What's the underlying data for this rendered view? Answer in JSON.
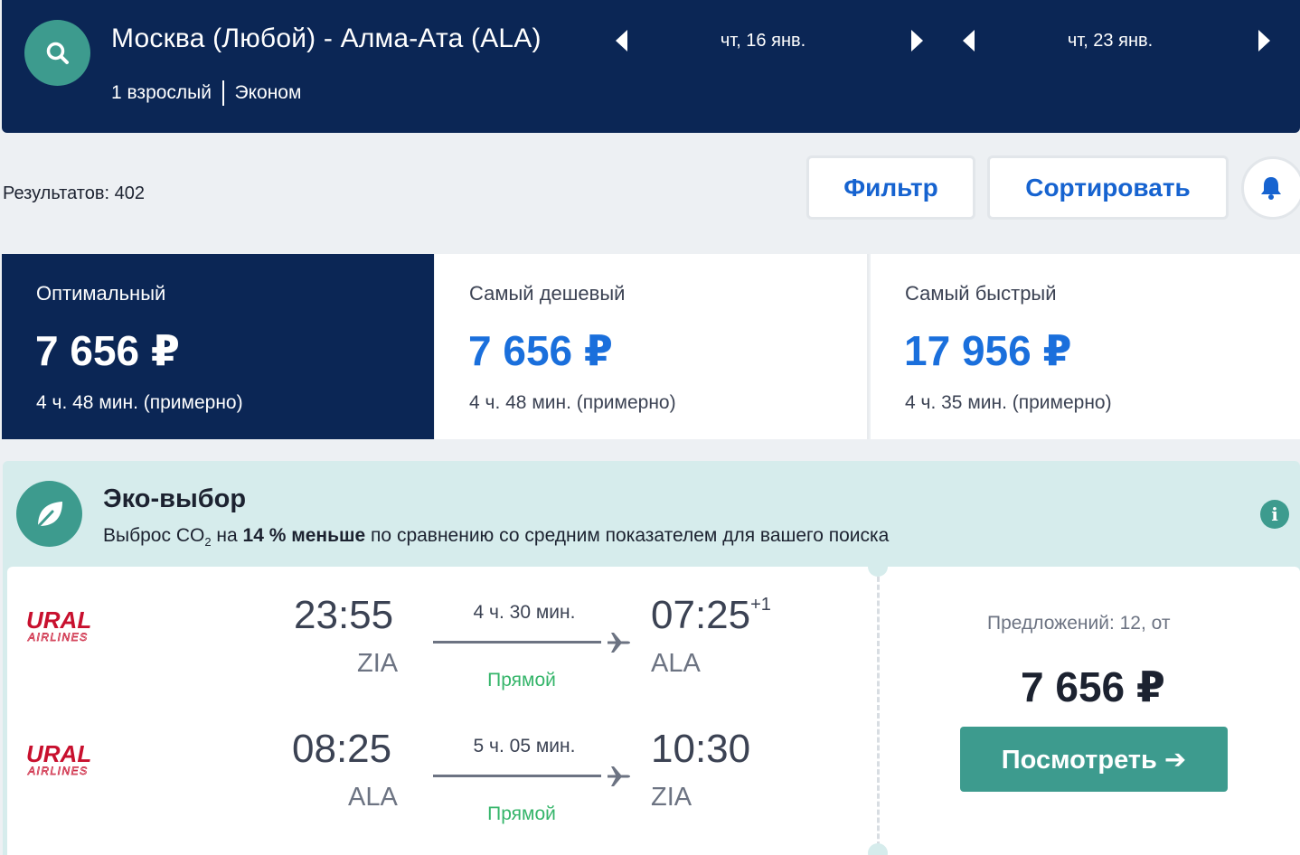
{
  "header": {
    "route": "Москва (Любой) - Алма-Ата (ALA)",
    "passengers": "1 взрослый",
    "cabin": "Эконом",
    "depart_date": "чт, 16 янв.",
    "return_date": "чт, 23 янв."
  },
  "toolbar": {
    "results": "Результатов: 402",
    "filter_label": "Фильтр",
    "sort_label": "Сортировать"
  },
  "tabs": [
    {
      "label": "Оптимальный",
      "price": "7 656 ₽",
      "duration": "4 ч. 48 мин. (примерно)",
      "active": true
    },
    {
      "label": "Самый дешевый",
      "price": "7 656 ₽",
      "duration": "4 ч. 48 мин. (примерно)",
      "active": false
    },
    {
      "label": "Самый быстрый",
      "price": "17 956 ₽",
      "duration": "4 ч. 35 мин. (примерно)",
      "active": false
    }
  ],
  "eco": {
    "title": "Эко-выбор",
    "text_before": "Выброс CO",
    "subscript": "2",
    "text_mid": " на ",
    "highlight": "14 % меньше",
    "text_after": " по сравнению со средним показателем для вашего поиска"
  },
  "flight": {
    "legs": [
      {
        "airline_top": "URAL",
        "airline_bottom": "AIRLINES",
        "dep_time": "23:55",
        "dep_airport": "ZIA",
        "duration": "4 ч. 30 мин.",
        "stops": "Прямой",
        "arr_time": "07:25",
        "arr_plus": "+1",
        "arr_airport": "ALA"
      },
      {
        "airline_top": "URAL",
        "airline_bottom": "AIRLINES",
        "dep_time": "08:25",
        "dep_airport": "ALA",
        "duration": "5 ч. 05 мин.",
        "stops": "Прямой",
        "arr_time": "10:30",
        "arr_plus": "",
        "arr_airport": "ZIA"
      }
    ],
    "offers": "Предложений: 12, от",
    "price": "7 656 ₽",
    "view_label": "Посмотреть ➔"
  },
  "icons": {
    "search": "search-icon",
    "bell": "bell-icon",
    "leaf": "leaf-icon",
    "info": "info-icon",
    "info_glyph": "i",
    "plane": "plane-icon"
  },
  "colors": {
    "header_bg": "#0b2655",
    "accent_teal": "#3d9b8e",
    "price_blue": "#1a6fdc",
    "direct_green": "#35b56a",
    "eco_bg": "#d6ecec",
    "airline_red": "#c8102e"
  }
}
